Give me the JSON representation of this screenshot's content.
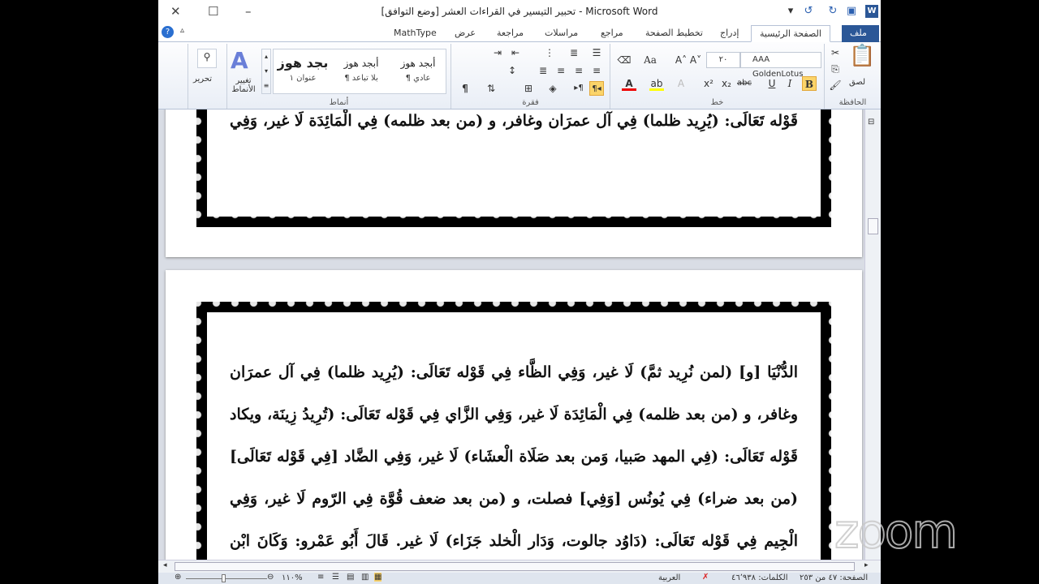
{
  "window": {
    "title": "تحبير التيسير في القراءات العشر [وضع التوافق] - Microsoft Word"
  },
  "tabs": [
    "ملف",
    "الصفحة الرئيسية",
    "إدراج",
    "تخطيط الصفحة",
    "مراجع",
    "مراسلات",
    "مراجعة",
    "عرض",
    "MathType"
  ],
  "ribbon": {
    "clipboard": {
      "label": "الحافظة",
      "paste": "لصق"
    },
    "font": {
      "label": "خط",
      "name": "AAA GoldenLotus",
      "size": "٢٠"
    },
    "paragraph": {
      "label": "فقرة"
    },
    "styles": {
      "label": "أنماط",
      "items": [
        {
          "preview": "أبجد هوز",
          "name": "¶ عادي"
        },
        {
          "preview": "أبجد هوز",
          "name": "¶ بلا تباعد"
        },
        {
          "preview": "بجد هوز",
          "name": "عنوان ١"
        }
      ],
      "change": "تغيير الأنماط"
    },
    "editing": {
      "label": "تحرير"
    }
  },
  "document": {
    "page1_lines": [
      "قَوْله تَعَالَى: (يُرِيد ظلما) فِي آل عمرَان وغافر، و (من بعد ظلمه) فِي الْمَائِدَة لَا غير، وَفِي"
    ],
    "page2_lines": [
      "الدُّنْيَا [و] (لمن نُرِيد ثمَّ) لَا غير، وَفِي الظَّاء فِي قَوْله تَعَالَى: (يُرِيد ظلما) فِي آل عمرَان",
      "وغافر، و (من بعد ظلمه) فِي الْمَائِدَة لَا غير، وَفِي الزَّاي فِي قَوْله تَعَالَى: (تُرِيدُ زِينَة، ويكاد",
      "قَوْله تَعَالَى: (فِي المهد صَبيا، وَمن بعد صَلَاة الْعشَاء) لَا غير، وَفِي الضَّاد [فِي قَوْله تَعَالَى]",
      "(من بعد ضراء) فِي يُونُس [وَفِي] فصلت، و (من بعد ضعف قُوَّة فِي الرّوم لَا غير، وَفِي",
      "الْجِيم فِي قَوْله تَعَالَى: (دَاوُد جالوت، وَدَار الْخلد جَزَاء) لَا غير. قَالَ أَبُو عَمْرو: وَكَانَ ابْن"
    ]
  },
  "status": {
    "page": "الصفحة: ٤٧ من ٢٥٣",
    "words": "الكلمات: ٤٦٬٩٣٨",
    "language": "العربية",
    "zoom": "١١٠%"
  },
  "overlay": {
    "logo": "zoom"
  }
}
